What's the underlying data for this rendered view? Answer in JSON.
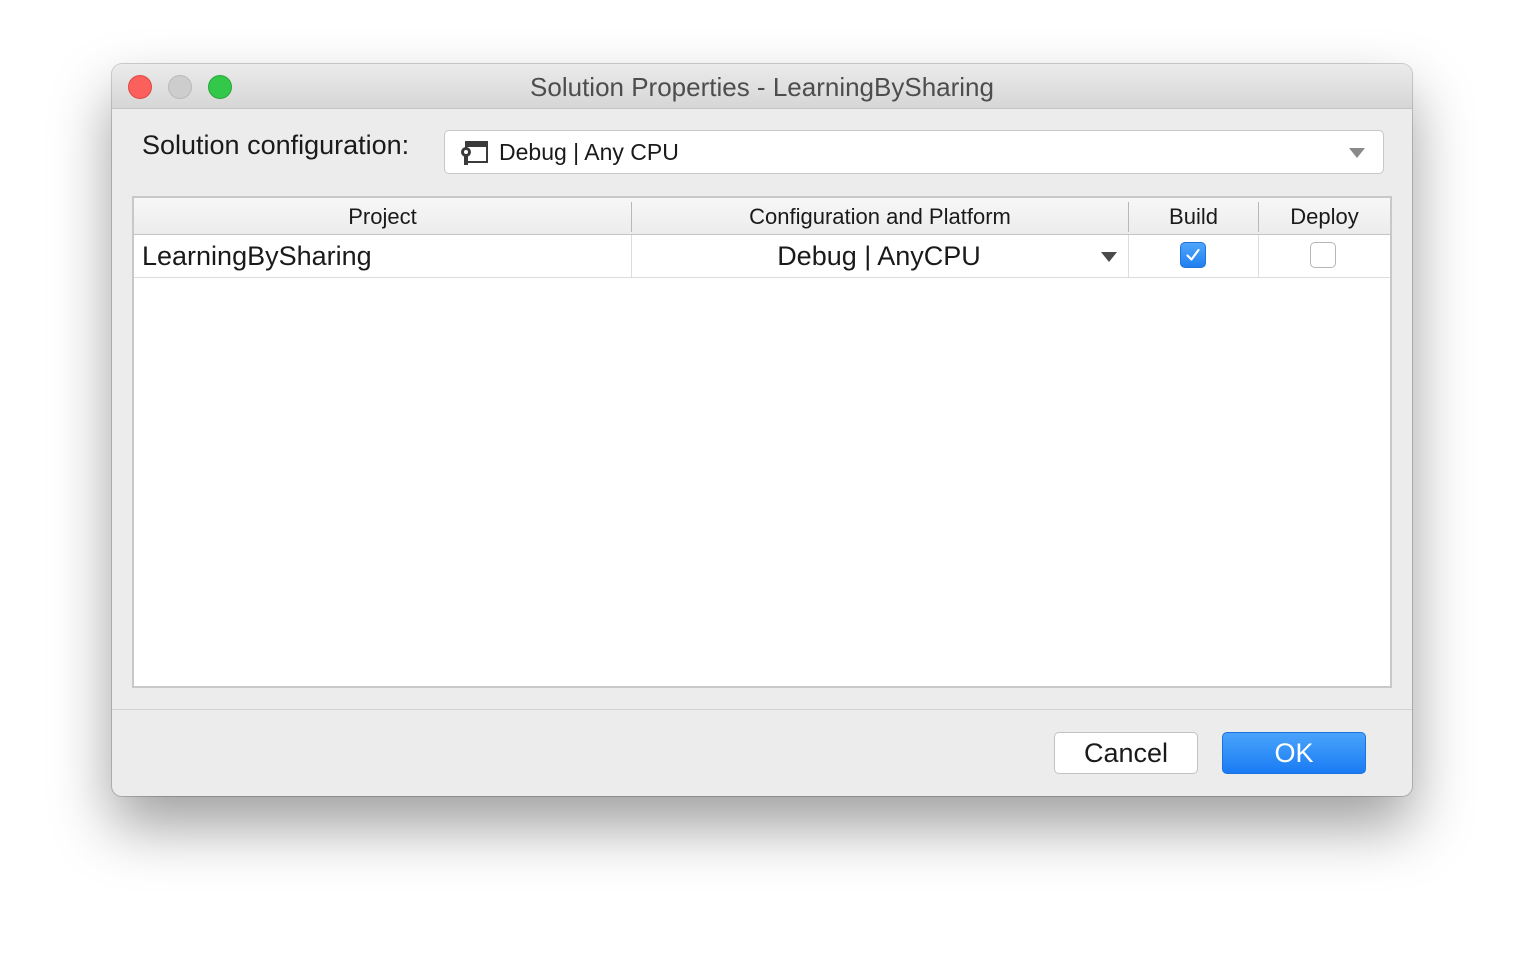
{
  "window": {
    "title": "Solution Properties - LearningBySharing"
  },
  "solution_config": {
    "label": "Solution configuration:",
    "value": "Debug | Any CPU",
    "icon": "configuration-icon"
  },
  "table": {
    "columns": [
      "Project",
      "Configuration and Platform",
      "Build",
      "Deploy"
    ],
    "rows": [
      {
        "project": "LearningBySharing",
        "configuration": "Debug | AnyCPU",
        "build": true,
        "deploy": false
      }
    ]
  },
  "buttons": {
    "cancel": "Cancel",
    "ok": "OK"
  },
  "colors": {
    "accent": "#1a7cf4",
    "close": "#fc605c",
    "minimize": "#cdcdcd",
    "maximize": "#34c84a"
  }
}
